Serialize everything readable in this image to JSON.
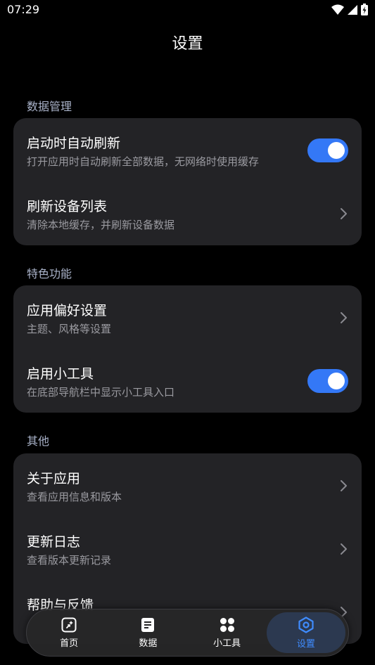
{
  "status_bar": {
    "time": "07:29"
  },
  "header": {
    "title": "设置"
  },
  "sections": [
    {
      "title": "数据管理",
      "items": [
        {
          "title": "启动时自动刷新",
          "subtitle": "打开应用时自动刷新全部数据，无网络时使用缓存",
          "control": "toggle",
          "on": true
        },
        {
          "title": "刷新设备列表",
          "subtitle": "清除本地缓存，并刷新设备数据",
          "control": "chevron"
        }
      ]
    },
    {
      "title": "特色功能",
      "items": [
        {
          "title": "应用偏好设置",
          "subtitle": "主题、风格等设置",
          "control": "chevron"
        },
        {
          "title": "启用小工具",
          "subtitle": "在底部导航栏中显示小工具入口",
          "control": "toggle",
          "on": true
        }
      ]
    },
    {
      "title": "其他",
      "items": [
        {
          "title": "关于应用",
          "subtitle": "查看应用信息和版本",
          "control": "chevron"
        },
        {
          "title": "更新日志",
          "subtitle": "查看版本更新记录",
          "control": "chevron"
        },
        {
          "title": "帮助与反馈",
          "subtitle": "",
          "control": "chevron"
        }
      ]
    }
  ],
  "nav": {
    "items": [
      {
        "label": "首页",
        "icon": "home-icon",
        "active": false
      },
      {
        "label": "数据",
        "icon": "document-icon",
        "active": false
      },
      {
        "label": "小工具",
        "icon": "grid-icon",
        "active": false
      },
      {
        "label": "设置",
        "icon": "settings-hexagon-icon",
        "active": true
      }
    ]
  },
  "colors": {
    "accent": "#3478f6",
    "card": "#232326",
    "section_title": "#a9b2c9",
    "nav_active": "#3f8cff"
  }
}
